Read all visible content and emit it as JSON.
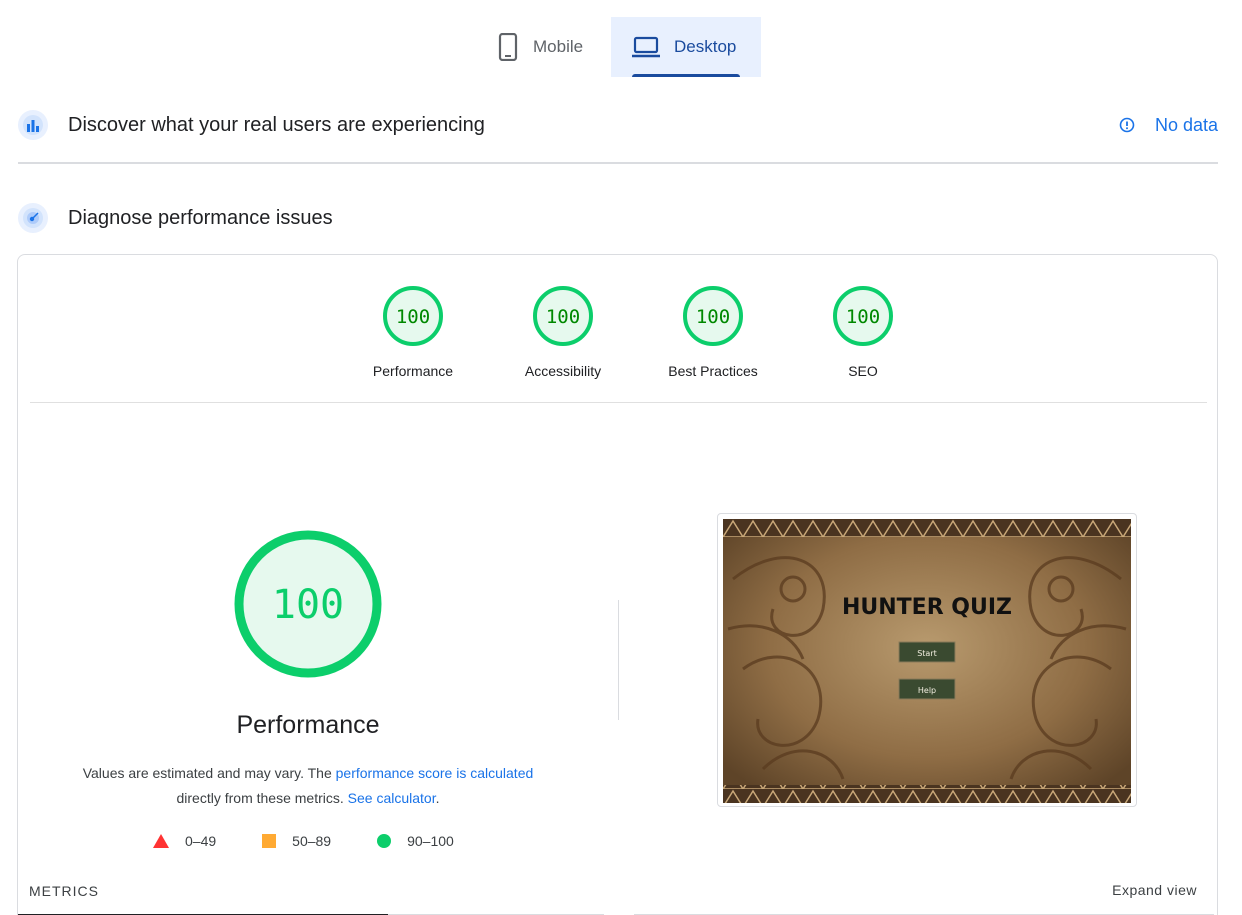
{
  "tabs": [
    {
      "label": "Mobile",
      "icon": "phone-icon",
      "active": false
    },
    {
      "label": "Desktop",
      "icon": "laptop-icon",
      "active": true
    }
  ],
  "crux": {
    "title": "Discover what your real users are experiencing",
    "status": "No data"
  },
  "diagnose": {
    "title": "Diagnose performance issues"
  },
  "categories": [
    {
      "label": "Performance",
      "score": "100"
    },
    {
      "label": "Accessibility",
      "score": "100"
    },
    {
      "label": "Best Practices",
      "score": "100"
    },
    {
      "label": "SEO",
      "score": "100"
    }
  ],
  "performance": {
    "score": "100",
    "title": "Performance",
    "desc_prefix": "Values are estimated and may vary. The ",
    "desc_link": "performance score is calculated",
    "desc_mid": " directly from these metrics. ",
    "desc_link2": "See calculator",
    "desc_suffix": "."
  },
  "legend": {
    "fail": "0–49",
    "average": "50–89",
    "pass": "90–100"
  },
  "screenshot": {
    "game_title": "HUNTER QUIZ",
    "start": "Start",
    "help": "Help"
  },
  "metrics": {
    "heading": "METRICS",
    "expand": "Expand view"
  },
  "colors": {
    "pass": "#0cce6b",
    "average": "#ffaa33",
    "fail": "#ff3333",
    "accent": "#1a73e8"
  }
}
